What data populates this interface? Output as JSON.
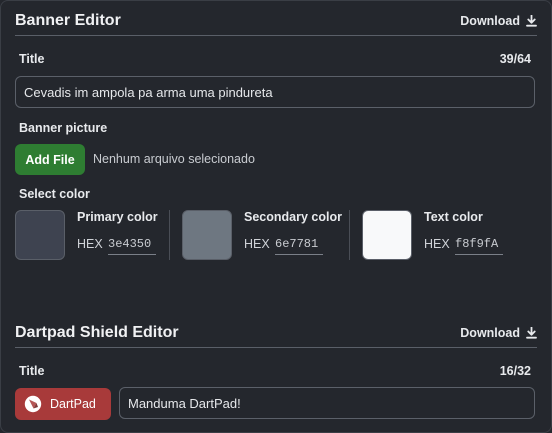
{
  "banner_editor": {
    "title": "Banner Editor",
    "download_label": "Download",
    "title_field": {
      "label": "Title",
      "counter": "39/64",
      "value": "Cevadis im ampola pa arma uma pindureta"
    },
    "picture": {
      "label": "Banner picture",
      "button_label": "Add File",
      "status": "Nenhum arquivo selecionado"
    },
    "colors": {
      "label": "Select color",
      "hex_prefix": "HEX",
      "items": [
        {
          "name": "Primary color",
          "hex": "3e4350",
          "swatch": "#3e4350"
        },
        {
          "name": "Secondary color",
          "hex": "6e7781",
          "swatch": "#6e7781"
        },
        {
          "name": "Text color",
          "hex": "f8f9fA",
          "swatch": "#f8f9fa"
        }
      ]
    }
  },
  "shield_editor": {
    "title": "Dartpad Shield Editor",
    "download_label": "Download",
    "title_field": {
      "label": "Title",
      "counter": "16/32",
      "value": "Manduma DartPad!"
    },
    "badge": {
      "label": "DartPad",
      "icon": "dartpad-logo-icon",
      "color": "#a83a3a"
    }
  },
  "colors": {
    "background": "#24272d",
    "border": "#5b6069",
    "add_file": "#2e7d32"
  }
}
